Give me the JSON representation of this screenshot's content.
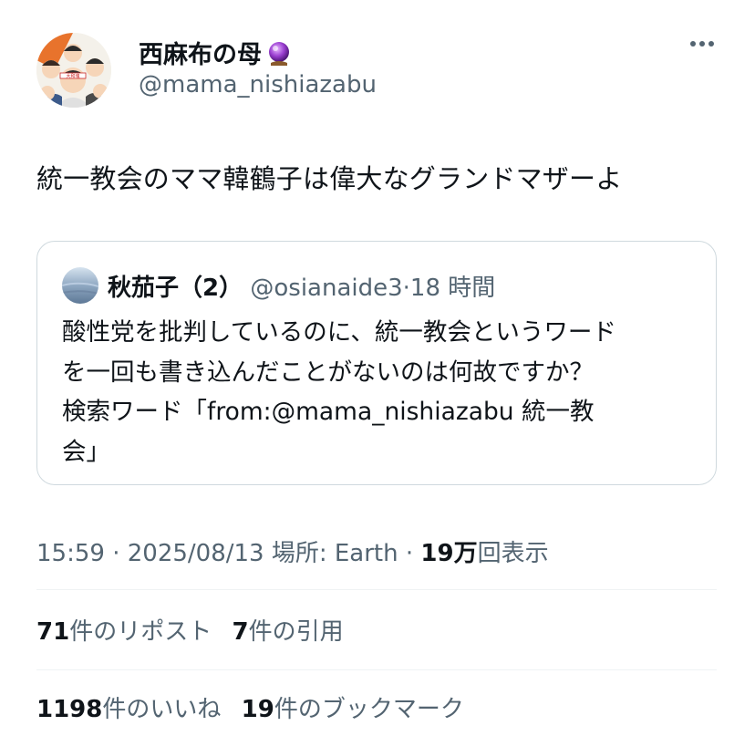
{
  "author": {
    "display_name": "西麻布の母",
    "name_emoji": "crystal-ball-icon",
    "handle": "@mama_nishiazabu",
    "avatar_sign": "大和魂"
  },
  "tweet": {
    "text": "統一教会のママ韓鶴子は偉大なグランドマザーよ"
  },
  "quote": {
    "name": "秋茄子（2）",
    "handle": "@osianaide3",
    "separator": "·",
    "time": "18 時間",
    "lines": [
      "酸性党を批判しているのに、統一教会というワード",
      "を一回も書き込んだことがないのは何故ですか？",
      "検索ワード「from:@mama_nishiazabu 統一教",
      "会」"
    ]
  },
  "meta": {
    "time": "15:59",
    "dot": "·",
    "date": "2025/08/13",
    "location": "場所: Earth",
    "views_count": "19万",
    "views_label": "回表示"
  },
  "stats": {
    "reposts_count": "71",
    "reposts_label": "件のリポスト",
    "quotes_count": "7",
    "quotes_label": "件の引用",
    "likes_count": "1198",
    "likes_label": "件のいいね",
    "bookmarks_count": "19",
    "bookmarks_label": "件のブックマーク"
  },
  "colors": {
    "text": "#0f1419",
    "secondary": "#536471",
    "border": "#cfd9de",
    "divider": "#eff3f4"
  }
}
